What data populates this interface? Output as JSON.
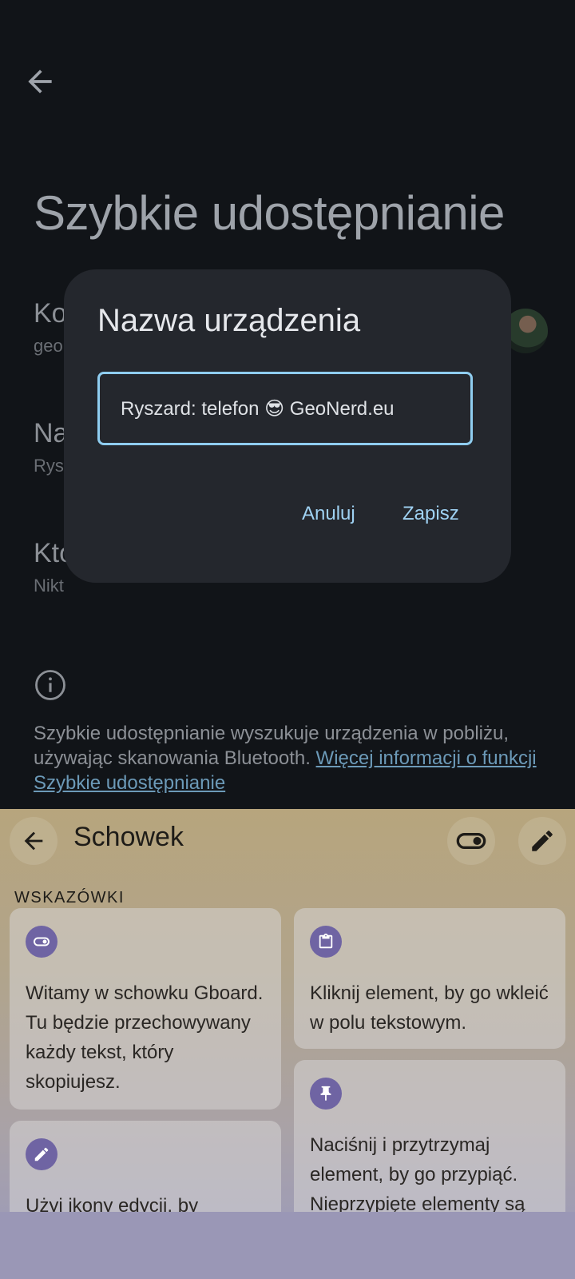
{
  "settings_page": {
    "title": "Szybkie udostępnianie",
    "items": [
      {
        "label": "Ko",
        "sub": "geo"
      },
      {
        "label": "Na",
        "sub": "Rys"
      },
      {
        "label": "Kto",
        "sub": "Nikt"
      }
    ],
    "info_text": "Szybkie udostępnianie wyszukuje urządzenia w pobliżu, używając skanowania Bluetooth. ",
    "info_link": "Więcej informacji o funkcji Szybkie udostępnianie"
  },
  "dialog": {
    "title": "Nazwa urządzenia",
    "input_value": "Ryszard: telefon 😎 GeoNerd.eu",
    "cancel_label": "Anuluj",
    "save_label": "Zapisz"
  },
  "clipboard": {
    "title": "Schowek",
    "section": "WSKAZÓWKI",
    "cards": [
      {
        "icon": "toggle-icon",
        "text": "Witamy w schowku Gboard. Tu będzie przechowywany każdy tekst, który skopiujesz."
      },
      {
        "icon": "clipboard-icon",
        "text": "Kliknij element, by go wkleić w polu tekstowym."
      },
      {
        "icon": "pencil-icon",
        "text": "Użyj ikony edycji, by"
      },
      {
        "icon": "pin-icon",
        "text": "Naciśnij i przytrzymaj element, by go przypiąć. Nieprzypięte elementy są"
      }
    ]
  },
  "colors": {
    "accent": "#9fd2f3",
    "dialog_bg": "#24272d",
    "badge": "#6f64a3"
  }
}
